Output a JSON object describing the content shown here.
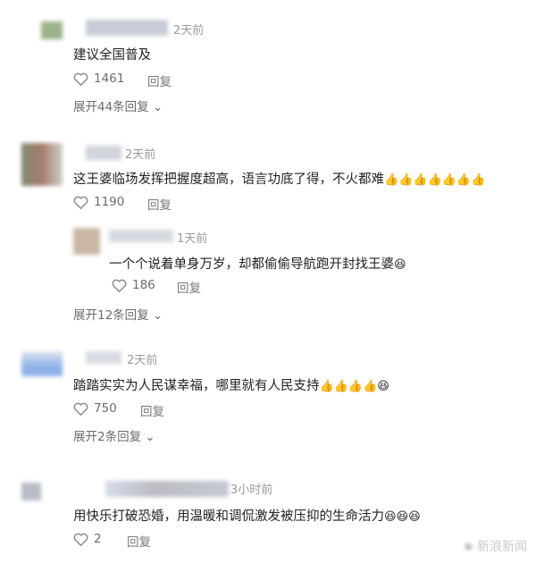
{
  "comments": [
    {
      "time": "2天前",
      "text": "建议全国普及",
      "emojis": "",
      "likes": "1461",
      "reply_label": "回复",
      "expand": "展开44条回复"
    },
    {
      "time": "2天前",
      "text": "这王婆临场发挥把握度超高，语言功底了得，不火都难",
      "emojis": "👍👍👍👍👍👍👍",
      "likes": "1190",
      "reply_label": "回复",
      "sub": {
        "time": "1天前",
        "text": "一个个说着单身万岁，却都偷偷导航跑开封找王婆",
        "emojis": "😆",
        "likes": "186",
        "reply_label": "回复"
      },
      "expand": "展开12条回复"
    },
    {
      "time": "2天前",
      "text": "踏踏实实为人民谋幸福，哪里就有人民支持",
      "emojis": "👍👍👍👍😆",
      "likes": "750",
      "reply_label": "回复",
      "expand": "展开2条回复"
    },
    {
      "time": "3小时前",
      "text": "用快乐打破恐婚，用温暖和调侃激发被压抑的生命活力",
      "emojis": "😆😆😆",
      "likes": "2",
      "reply_label": "回复",
      "expand": ""
    }
  ],
  "watermark": "新浪新闻",
  "icons": {
    "like": "heart-outline-icon",
    "chevron": "chevron-down-icon",
    "watermark": "weibo-logo-icon"
  }
}
